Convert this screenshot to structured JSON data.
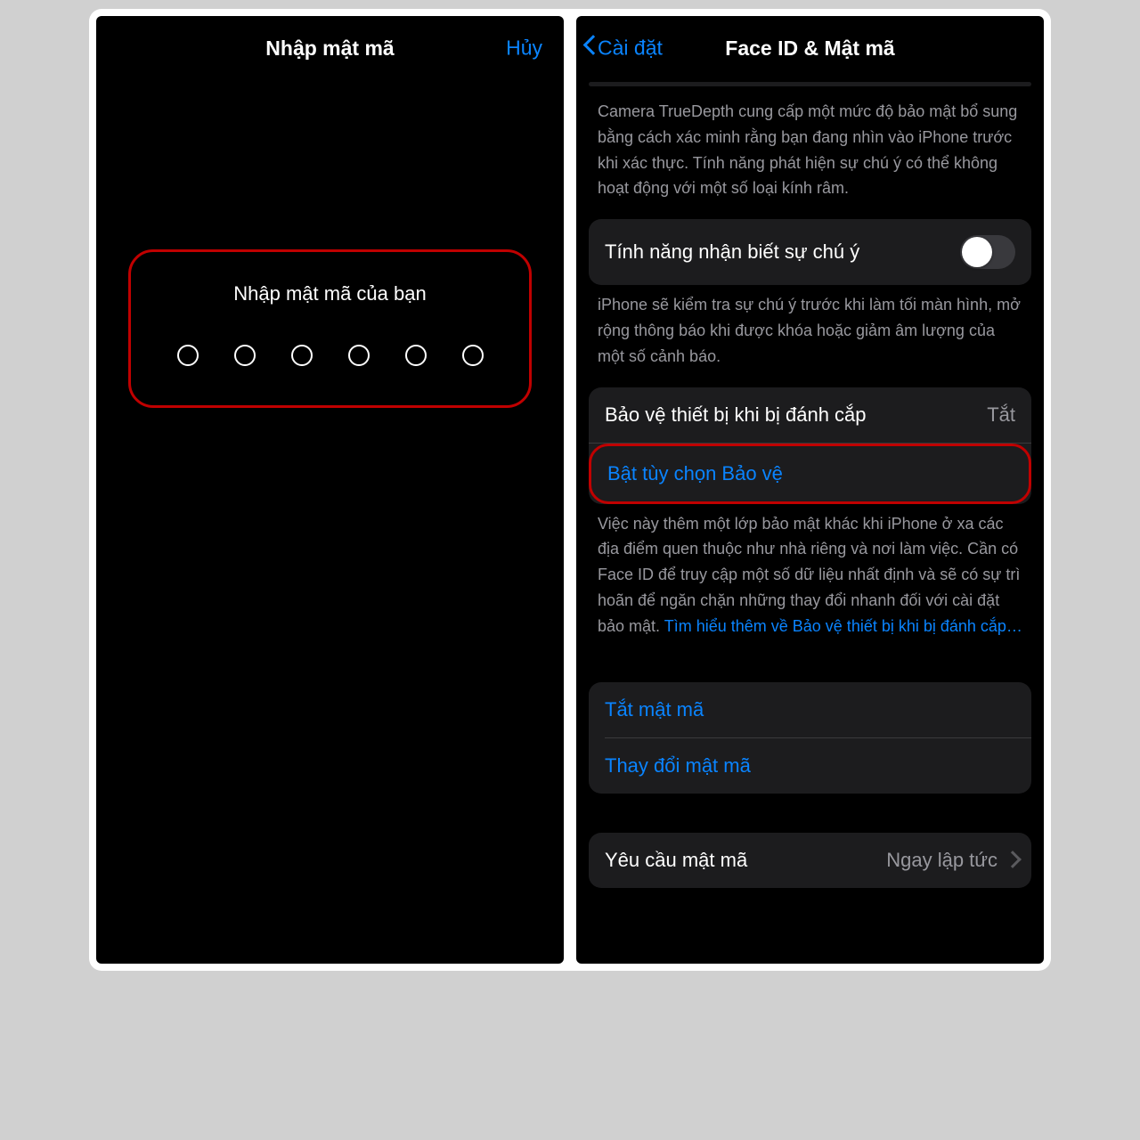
{
  "left": {
    "title": "Nhập mật mã",
    "cancel": "Hủy",
    "prompt": "Nhập mật mã của bạn",
    "digit_count": 6
  },
  "right": {
    "back_label": "Cài đặt",
    "title": "Face ID & Mật mã",
    "truedepth_desc": "Camera TrueDepth cung cấp một mức độ bảo mật bổ sung bằng cách xác minh rằng bạn đang nhìn vào iPhone trước khi xác thực. Tính năng phát hiện sự chú ý có thể không hoạt động với một số loại kính râm.",
    "attention_toggle": {
      "label": "Tính năng nhận biết sự chú ý",
      "on": false
    },
    "attention_desc": "iPhone sẽ kiểm tra sự chú ý trước khi làm tối màn hình, mở rộng thông báo khi được khóa hoặc giảm âm lượng của một số cảnh báo.",
    "stolen": {
      "label": "Bảo vệ thiết bị khi bị đánh cắp",
      "value": "Tắt",
      "enable_label": "Bật tùy chọn Bảo vệ"
    },
    "stolen_desc": "Việc này thêm một lớp bảo mật khác khi iPhone ở xa các địa điểm quen thuộc như nhà riêng và nơi làm việc. Cần có Face ID để truy cập một số dữ liệu nhất định và sẽ có sự trì hoãn để ngăn chặn những thay đổi nhanh đối với cài đặt bảo mật. ",
    "stolen_learn_more": "Tìm hiểu thêm về Bảo vệ thiết bị khi bị đánh cắp…",
    "passcode_off": "Tắt mật mã",
    "change_passcode": "Thay đổi mật mã",
    "require": {
      "label": "Yêu cầu mật mã",
      "value": "Ngay lập tức"
    }
  }
}
